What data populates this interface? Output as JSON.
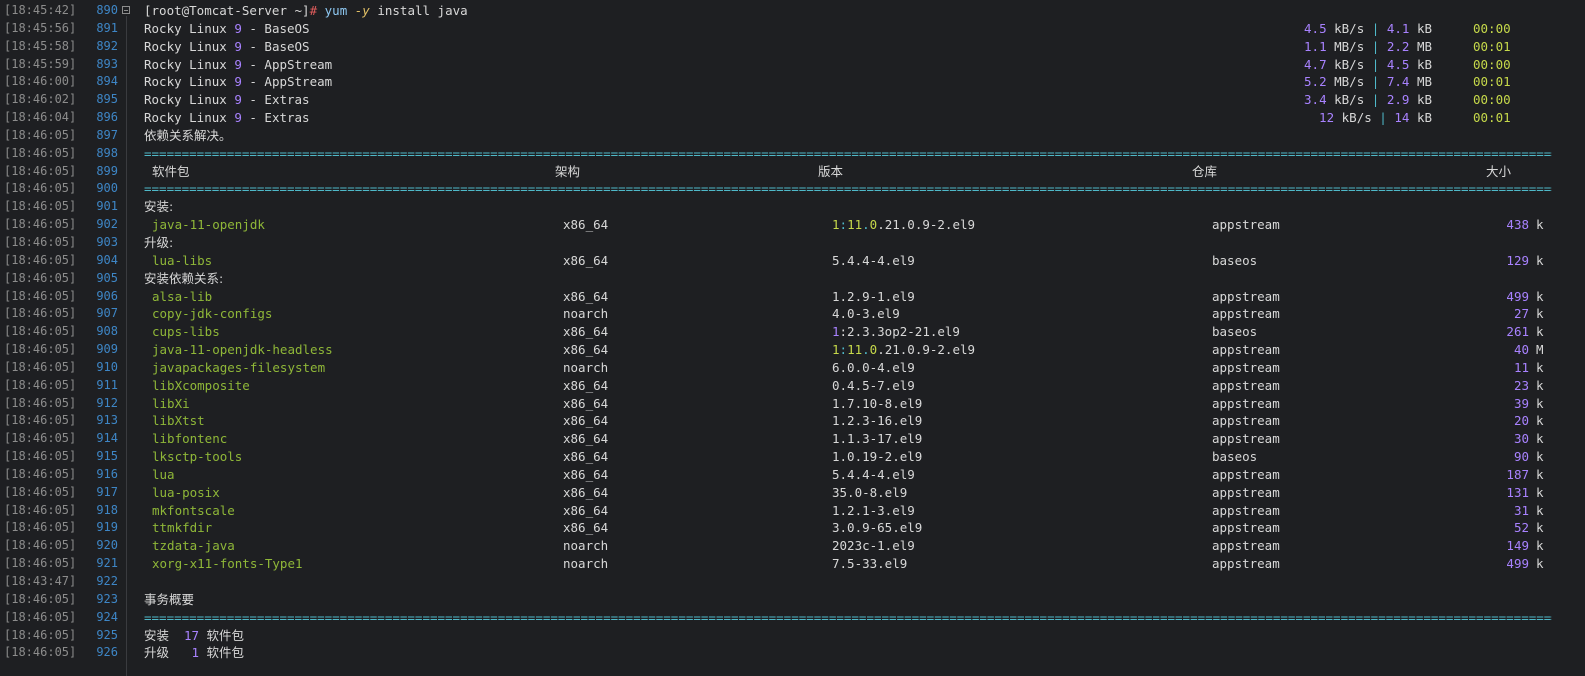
{
  "prompt": {
    "user_host": "[root@Tomcat-Server ~]",
    "hash": "#",
    "cmd": "yum",
    "opt": "-y",
    "args": "install java"
  },
  "repos": [
    {
      "a": "Rocky Linux ",
      "n": "9",
      "b": " - BaseOS",
      "rate": "4.5",
      "rate_unit": "kB/s",
      "size": "4.1",
      "size_unit": "kB",
      "time": "00:00"
    },
    {
      "a": "Rocky Linux ",
      "n": "9",
      "b": " - BaseOS",
      "rate": "1.1",
      "rate_unit": "MB/s",
      "size": "2.2",
      "size_unit": "MB",
      "time": "00:01"
    },
    {
      "a": "Rocky Linux ",
      "n": "9",
      "b": " - AppStream",
      "rate": "4.7",
      "rate_unit": "kB/s",
      "size": "4.5",
      "size_unit": "kB",
      "time": "00:00"
    },
    {
      "a": "Rocky Linux ",
      "n": "9",
      "b": " - AppStream",
      "rate": "5.2",
      "rate_unit": "MB/s",
      "size": "7.4",
      "size_unit": "MB",
      "time": "00:01"
    },
    {
      "a": "Rocky Linux ",
      "n": "9",
      "b": " - Extras",
      "rate": "3.4",
      "rate_unit": "kB/s",
      "size": "2.9",
      "size_unit": "kB",
      "time": "00:00"
    },
    {
      "a": "Rocky Linux ",
      "n": "9",
      "b": " - Extras",
      "rate": "12",
      "rate_unit": "kB/s",
      "size": "14",
      "size_unit": "kB",
      "time": "00:01"
    }
  ],
  "deps_resolved": "依赖关系解决。",
  "separator": "======================================================================================================================================================================================================================================",
  "headers": {
    "pkg": "软件包",
    "arch": "架构",
    "ver": "版本",
    "repo": "仓库",
    "size": "大小"
  },
  "sections": {
    "install": "安装:",
    "upgrade": "升级:",
    "install_deps": "安装依赖关系:"
  },
  "install_pkgs": [
    {
      "name": "java-11-openjdk",
      "arch": "x86_64",
      "epoch": "1",
      "colon": ":",
      "v1": "11",
      "dot": ".",
      "v2": "0",
      "rest": ".21.0.9-2.el9",
      "repo": "appstream",
      "size": "438",
      "unit": "k"
    }
  ],
  "upgrade_pkgs": [
    {
      "name": "lua-libs",
      "arch": "x86_64",
      "ver": "5.4.4-4.el9",
      "repo": "baseos",
      "size": "129",
      "unit": "k"
    }
  ],
  "dep_pkgs": [
    {
      "name": "alsa-lib",
      "arch": "x86_64",
      "ver": "1.2.9-1.el9",
      "repo": "appstream",
      "size": "499",
      "unit": "k"
    },
    {
      "name": "copy-jdk-configs",
      "arch": "noarch",
      "ver": "4.0-3.el9",
      "repo": "appstream",
      "size": "27",
      "unit": "k"
    },
    {
      "name": "cups-libs",
      "arch": "x86_64",
      "epoch": "1",
      "ver": ":2.3.3op2-21.el9",
      "repo": "baseos",
      "size": "261",
      "unit": "k"
    },
    {
      "name": "java-11-openjdk-headless",
      "arch": "x86_64",
      "epoch": "1",
      "colon": ":",
      "v1": "11",
      "dot": ".",
      "v2": "0",
      "rest": ".21.0.9-2.el9",
      "repo": "appstream",
      "size": "40",
      "unit": "M"
    },
    {
      "name": "javapackages-filesystem",
      "arch": "noarch",
      "ver": "6.0.0-4.el9",
      "repo": "appstream",
      "size": "11",
      "unit": "k"
    },
    {
      "name": "libXcomposite",
      "arch": "x86_64",
      "ver": "0.4.5-7.el9",
      "repo": "appstream",
      "size": "23",
      "unit": "k"
    },
    {
      "name": "libXi",
      "arch": "x86_64",
      "ver": "1.7.10-8.el9",
      "repo": "appstream",
      "size": "39",
      "unit": "k"
    },
    {
      "name": "libXtst",
      "arch": "x86_64",
      "ver": "1.2.3-16.el9",
      "repo": "appstream",
      "size": "20",
      "unit": "k"
    },
    {
      "name": "libfontenc",
      "arch": "x86_64",
      "ver": "1.1.3-17.el9",
      "repo": "appstream",
      "size": "30",
      "unit": "k"
    },
    {
      "name": "lksctp-tools",
      "arch": "x86_64",
      "ver": "1.0.19-2.el9",
      "repo": "baseos",
      "size": "90",
      "unit": "k"
    },
    {
      "name": "lua",
      "arch": "x86_64",
      "ver": "5.4.4-4.el9",
      "repo": "appstream",
      "size": "187",
      "unit": "k"
    },
    {
      "name": "lua-posix",
      "arch": "x86_64",
      "ver": "35.0-8.el9",
      "repo": "appstream",
      "size": "131",
      "unit": "k"
    },
    {
      "name": "mkfontscale",
      "arch": "x86_64",
      "ver": "1.2.1-3.el9",
      "repo": "appstream",
      "size": "31",
      "unit": "k"
    },
    {
      "name": "ttmkfdir",
      "arch": "x86_64",
      "ver": "3.0.9-65.el9",
      "repo": "appstream",
      "size": "52",
      "unit": "k"
    },
    {
      "name": "tzdata-java",
      "arch": "noarch",
      "ver": "2023c-1.el9",
      "repo": "appstream",
      "size": "149",
      "unit": "k"
    },
    {
      "name": "xorg-x11-fonts-Type1",
      "arch": "noarch",
      "ver": "7.5-33.el9",
      "repo": "appstream",
      "size": "499",
      "unit": "k"
    }
  ],
  "summary_title": "事务概要",
  "summary": [
    {
      "label": "安装",
      "count": "17",
      "unit": "软件包"
    },
    {
      "label": "升级",
      "count": "1",
      "unit": "软件包"
    }
  ],
  "timestamps": [
    "[18:45:42]",
    "[18:45:56]",
    "[18:45:58]",
    "[18:45:59]",
    "[18:46:00]",
    "[18:46:02]",
    "[18:46:04]",
    "[18:46:05]",
    "[18:46:05]",
    "[18:46:05]",
    "[18:46:05]",
    "[18:46:05]",
    "[18:46:05]",
    "[18:46:05]",
    "[18:46:05]",
    "[18:46:05]",
    "[18:46:05]",
    "[18:46:05]",
    "[18:46:05]",
    "[18:46:05]",
    "[18:46:05]",
    "[18:46:05]",
    "[18:46:05]",
    "[18:46:05]",
    "[18:46:05]",
    "[18:46:05]",
    "[18:46:05]",
    "[18:46:05]",
    "[18:46:05]",
    "[18:46:05]",
    "[18:46:05]",
    "[18:46:05]",
    "[18:43:47]",
    "[18:46:05]",
    "[18:46:05]",
    "[18:46:05]",
    "[18:46:05]"
  ],
  "line_numbers": [
    "890",
    "891",
    "892",
    "893",
    "894",
    "895",
    "896",
    "897",
    "898",
    "899",
    "900",
    "901",
    "902",
    "903",
    "904",
    "905",
    "906",
    "907",
    "908",
    "909",
    "910",
    "911",
    "912",
    "913",
    "914",
    "915",
    "916",
    "917",
    "918",
    "919",
    "920",
    "921",
    "922",
    "923",
    "924",
    "925",
    "926"
  ]
}
